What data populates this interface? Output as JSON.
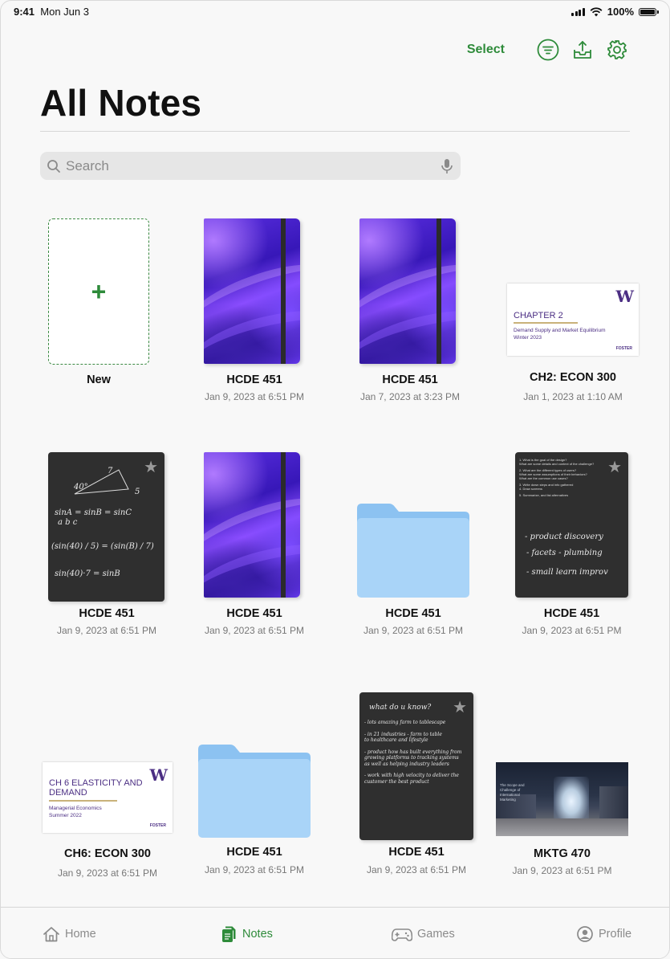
{
  "status": {
    "time": "9:41",
    "date": "Mon Jun 3",
    "battery": "100%"
  },
  "toolbar": {
    "select_label": "Select",
    "icons": [
      "filter-icon",
      "share-icon",
      "gear-icon"
    ]
  },
  "page_title": "All Notes",
  "search": {
    "placeholder": "Search"
  },
  "new_label": "New",
  "notes": [
    {
      "title": "HCDE 451",
      "date": "Jan 9, 2023 at 6:51 PM"
    },
    {
      "title": "HCDE 451",
      "date": "Jan 7, 2023 at 3:23 PM"
    },
    {
      "title": "CH2:  ECON 300",
      "date": "Jan 1, 2023 at 1:10 AM"
    },
    {
      "title": "HCDE 451",
      "date": "Jan 9, 2023 at 6:51 PM"
    },
    {
      "title": "HCDE 451",
      "date": "Jan 9, 2023 at 6:51 PM"
    },
    {
      "title": "HCDE 451",
      "date": "Jan 9, 2023 at 6:51 PM"
    },
    {
      "title": "HCDE 451",
      "date": "Jan 9, 2023 at 6:51 PM"
    },
    {
      "title": "CH6: ECON 300",
      "date": "Jan 9, 2023 at 6:51 PM"
    },
    {
      "title": "HCDE 451",
      "date": "Jan 9, 2023 at 6:51 PM"
    },
    {
      "title": "HCDE 451",
      "date": "Jan 9, 2023 at 6:51 PM"
    },
    {
      "title": "MKTG 470",
      "date": "Jan 9, 2023 at 6:51 PM"
    }
  ],
  "slides": {
    "ch2": {
      "title": "CHAPTER 2",
      "sub1": "Demand Supply and Market Equilibrium",
      "sub2": "Winter 2023",
      "logo": "W",
      "footer": "FOSTER"
    },
    "ch6": {
      "title1": "CH 6 ELASTICITY AND",
      "title2": "DEMAND",
      "sub1": "Managerial Economics",
      "sub2": "Summer 2022",
      "logo": "W",
      "footer": "FOSTER"
    },
    "mktg": {
      "text1": "The Scope and",
      "text2": "Challenge of",
      "text3": "International",
      "text4": "Marketing"
    }
  },
  "handwriting": {
    "note_a": [
      "sinA = sinB = sinC",
      "a      b      c",
      "(sin(40) / 5) = (sin(B) / 7)",
      "sin(40)·7 = sinB",
      "40°",
      "7",
      "5"
    ],
    "note_b": [
      "1. What is the goal of the design?",
      "What are some details and context of the challenge?",
      "2. What are the different types of users?",
      "What are some assumptions of their behaviors?",
      "What are the common use cases?",
      "3. Write down steps and info gathered",
      "4. Draw screens",
      "5. Summarize, and list alternatives",
      "- product discovery",
      "- facets - plumbing",
      "- small learn improv"
    ],
    "note_c": [
      "what do u know?",
      "- lots amazing farm to tablescape",
      "- in 21 industries - farm to table",
      "  to healthcare and lifestyle",
      "- product how has built everything from",
      "  growing platforms to tracking systems",
      "  as well as helping industry leaders",
      "- work with high velocity to deliver the",
      "  customer the best product"
    ]
  },
  "tabs": [
    {
      "label": "Home",
      "icon": "home-icon",
      "active": false
    },
    {
      "label": "Notes",
      "icon": "notes-icon",
      "active": true
    },
    {
      "label": "Games",
      "icon": "gamepad-icon",
      "active": false
    },
    {
      "label": "Profile",
      "icon": "profile-icon",
      "active": false
    }
  ],
  "colors": {
    "accent": "#2e8b3a",
    "folder": "#a9d4f8",
    "folder_tab": "#8cc2f1",
    "slide_purple": "#4b2e83",
    "dark_note": "#2f2f2f"
  }
}
